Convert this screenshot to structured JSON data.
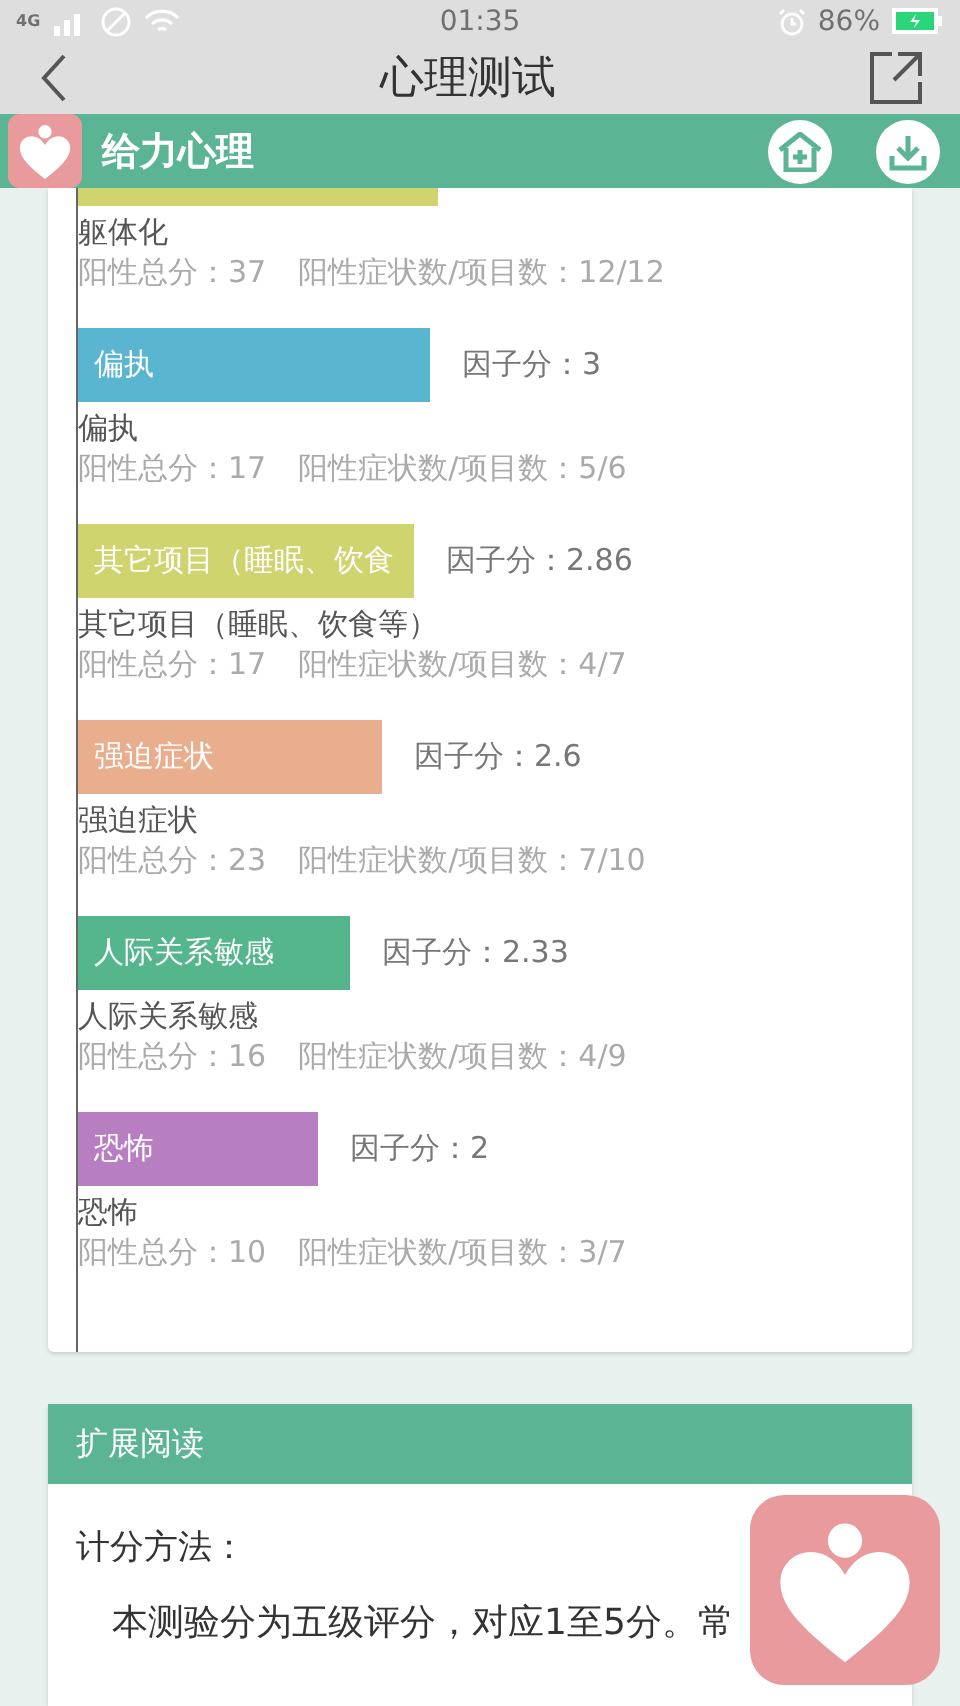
{
  "status_bar": {
    "network": "4G",
    "time": "01:35",
    "battery": "86%"
  },
  "nav": {
    "title": "心理测试"
  },
  "brand": {
    "name": "给力心理"
  },
  "factors": [
    {
      "kind": "cut",
      "color": "#cfd46e",
      "name": "躯体化",
      "positive_total": "阳性总分：37",
      "ratio": "阳性症状数/项目数：12/12"
    },
    {
      "kind": "full",
      "color": "#5ab5d0",
      "bar_label": "偏执",
      "score": "因子分：3",
      "name": "偏执",
      "positive_total": "阳性总分：17",
      "ratio": "阳性症状数/项目数：5/6"
    },
    {
      "kind": "full",
      "color": "#cfd46e",
      "bar_label": "其它项目（睡眠、饮食",
      "score": "因子分：2.86",
      "name": "其它项目（睡眠、饮食等）",
      "positive_total": "阳性总分：17",
      "ratio": "阳性症状数/项目数：4/7"
    },
    {
      "kind": "full",
      "color": "#e9ae8e",
      "bar_label": "强迫症状",
      "score": "因子分：2.6",
      "name": "强迫症状",
      "positive_total": "阳性总分：23",
      "ratio": "阳性症状数/项目数：7/10"
    },
    {
      "kind": "full",
      "color": "#55b68d",
      "bar_label": "人际关系敏感",
      "score": "因子分：2.33",
      "name": "人际关系敏感",
      "positive_total": "阳性总分：16",
      "ratio": "阳性症状数/项目数：4/9"
    },
    {
      "kind": "full",
      "color": "#b77fc2",
      "bar_label": "恐怖",
      "score": "因子分：2",
      "name": "恐怖",
      "positive_total": "阳性总分：10",
      "ratio": "阳性症状数/项目数：3/7"
    }
  ],
  "reading": {
    "header": "扩展阅读",
    "heading": "计分方法：",
    "paragraph": "本测验分为五级评分，对应1至5分。常"
  }
}
